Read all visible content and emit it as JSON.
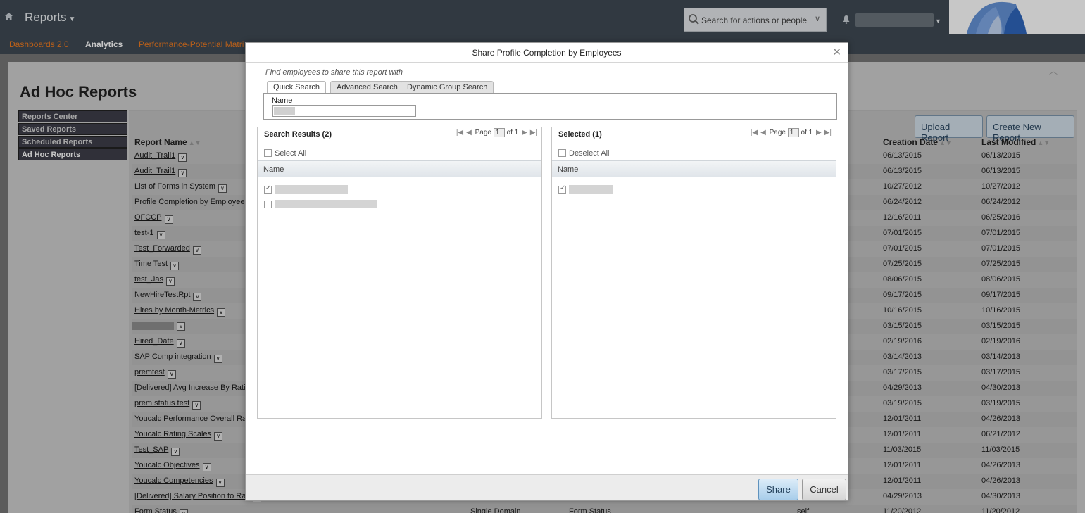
{
  "header": {
    "title": "Reports",
    "search_placeholder": "Search for actions or people"
  },
  "nav": {
    "items": [
      "Dashboards 2.0",
      "Analytics",
      "Performance-Potential Matri"
    ],
    "active": "Analytics"
  },
  "page": {
    "title": "Ad Hoc Reports",
    "sidebar": [
      "Reports Center",
      "Saved Reports",
      "Scheduled Reports",
      "Ad Hoc Reports"
    ],
    "buttons": {
      "upload": "Upload Report",
      "create": "Create New Report"
    },
    "columns": {
      "name": "Report Name",
      "creation": "Creation Date",
      "modified": "Last Modified"
    },
    "rows": [
      {
        "name": "Audit_Trail1",
        "created": "06/13/2015",
        "modified": "06/13/2015"
      },
      {
        "name": "Audit_Trail1",
        "created": "06/13/2015",
        "modified": "06/13/2015"
      },
      {
        "name": "List of Forms in System",
        "created": "10/27/2012",
        "modified": "10/27/2012"
      },
      {
        "name": "Profile Completion by Employees",
        "created": "06/24/2012",
        "modified": "06/24/2012"
      },
      {
        "name": "OFCCP",
        "created": "12/16/2011",
        "modified": "06/25/2016"
      },
      {
        "name": "test-1",
        "created": "07/01/2015",
        "modified": "07/01/2015"
      },
      {
        "name": "Test_Forwarded",
        "created": "07/01/2015",
        "modified": "07/01/2015"
      },
      {
        "name": "Time Test",
        "created": "07/25/2015",
        "modified": "07/25/2015"
      },
      {
        "name": "test_Jas",
        "created": "08/06/2015",
        "modified": "08/06/2015"
      },
      {
        "name": "NewHireTestRpt",
        "created": "09/17/2015",
        "modified": "09/17/2015"
      },
      {
        "name": "Hires by Month-Metrics",
        "created": "10/16/2015",
        "modified": "10/16/2015"
      },
      {
        "name": "",
        "created": "03/15/2015",
        "modified": "03/15/2015"
      },
      {
        "name": "Hired_Date",
        "created": "02/19/2016",
        "modified": "02/19/2016"
      },
      {
        "name": "SAP Comp integration",
        "created": "03/14/2013",
        "modified": "03/14/2013"
      },
      {
        "name": "premtest",
        "created": "03/17/2015",
        "modified": "03/17/2015"
      },
      {
        "name": "[Delivered] Avg Increase By Ratin",
        "created": "04/29/2013",
        "modified": "04/30/2013"
      },
      {
        "name": "prem status test",
        "created": "03/19/2015",
        "modified": "03/19/2015"
      },
      {
        "name": "Youcalc Performance Overall Rat",
        "created": "12/01/2011",
        "modified": "04/26/2013"
      },
      {
        "name": "Youcalc Rating Scales",
        "created": "12/01/2011",
        "modified": "06/21/2012"
      },
      {
        "name": "Test_SAP",
        "created": "11/03/2015",
        "modified": "11/03/2015"
      },
      {
        "name": "Youcalc Objectives",
        "created": "12/01/2011",
        "modified": "04/26/2013"
      },
      {
        "name": "Youcalc Competencies",
        "created": "12/01/2011",
        "modified": "04/26/2013"
      },
      {
        "name": "[Delivered] Salary Position to Ran",
        "created": "04/29/2013",
        "modified": "04/30/2013"
      },
      {
        "name": "Form Status",
        "created": "11/20/2012",
        "modified": "11/20/2012",
        "type": "Single Domain",
        "domain": "Form Status",
        "owner": "self"
      }
    ]
  },
  "modal": {
    "title": "Share Profile Completion by Employees",
    "find_label": "Find employees to share this report with",
    "tabs": [
      "Quick Search",
      "Advanced Search",
      "Dynamic Group Search"
    ],
    "name_label": "Name",
    "left": {
      "title": "Search Results (2)",
      "select_all": "Select All",
      "column": "Name",
      "page_label": "Page",
      "page": "1",
      "of": "of 1"
    },
    "right": {
      "title": "Selected (1)",
      "deselect_all": "Deselect All",
      "column": "Name",
      "page_label": "Page",
      "page": "1",
      "of": "of 1"
    },
    "share": "Share",
    "cancel": "Cancel"
  }
}
